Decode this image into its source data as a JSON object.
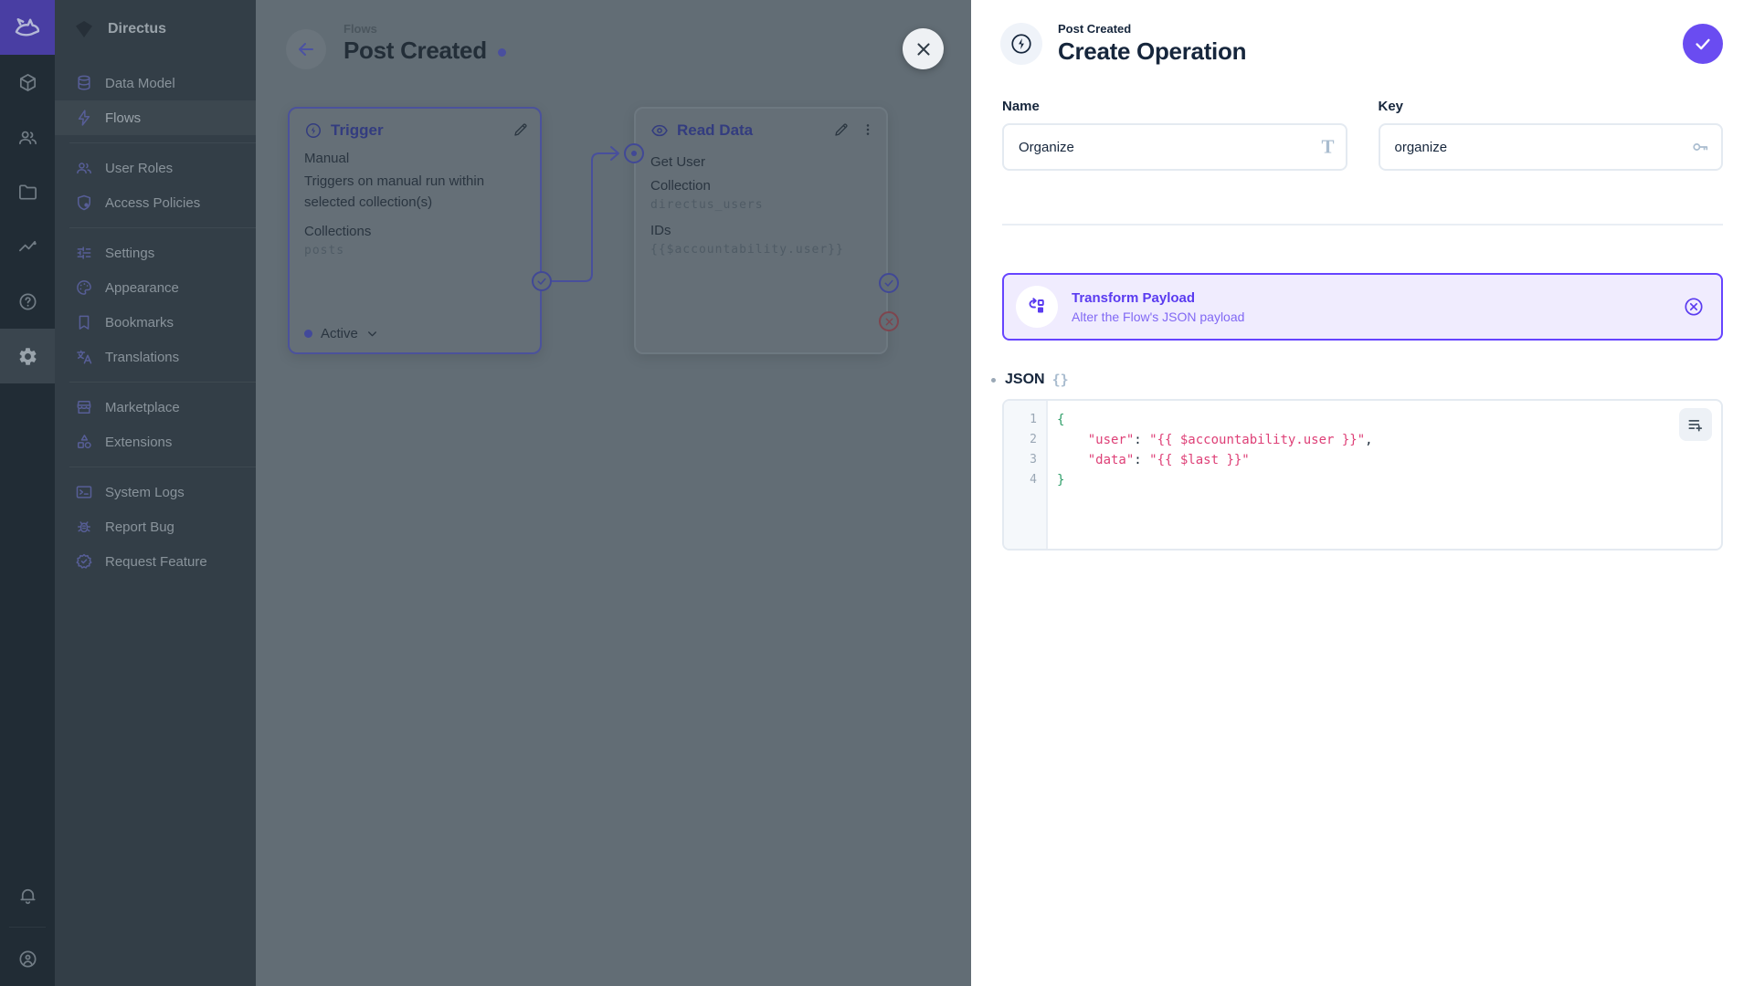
{
  "colors": {
    "brand_accent": "#6644ff",
    "save_button": "#6a4cf1",
    "card_border": "#6644ff",
    "code_bracket_green": "#2f9e69",
    "code_string_rose": "#de4077"
  },
  "module_bar": {
    "modules": [
      "content",
      "users",
      "files",
      "insights",
      "help",
      "settings"
    ],
    "active_module": "settings",
    "bottom": [
      "notifications",
      "avatar"
    ]
  },
  "sidebar": {
    "project_name": "Directus",
    "groups": [
      {
        "items": [
          {
            "label": "Data Model"
          },
          {
            "label": "Flows",
            "active": true
          }
        ]
      },
      {
        "items": [
          {
            "label": "User Roles"
          },
          {
            "label": "Access Policies"
          }
        ]
      },
      {
        "items": [
          {
            "label": "Settings"
          },
          {
            "label": "Appearance"
          },
          {
            "label": "Bookmarks"
          },
          {
            "label": "Translations"
          }
        ]
      },
      {
        "items": [
          {
            "label": "Marketplace"
          },
          {
            "label": "Extensions"
          }
        ]
      },
      {
        "items": [
          {
            "label": "System Logs"
          },
          {
            "label": "Report Bug"
          },
          {
            "label": "Request Feature"
          }
        ]
      }
    ]
  },
  "canvas": {
    "breadcrumb": "Flows",
    "title": "Post Created",
    "trigger": {
      "header": "Trigger",
      "type": "Manual",
      "description": "Triggers on manual run within selected collection(s)",
      "collections_label": "Collections",
      "collections_value": "posts",
      "status": "Active"
    },
    "read_data": {
      "header": "Read Data",
      "name": "Get User",
      "collection_label": "Collection",
      "collection_value": "directus_users",
      "ids_label": "IDs",
      "ids_value": "{{$accountability.user}}"
    }
  },
  "drawer": {
    "subtitle": "Post Created",
    "title": "Create Operation",
    "name_field": {
      "label": "Name",
      "value": "Organize",
      "icon_glyph": "T"
    },
    "key_field": {
      "label": "Key",
      "value": "organize"
    },
    "card": {
      "title": "Transform Payload",
      "subtitle": "Alter the Flow's JSON payload"
    },
    "json_section": {
      "label": "JSON",
      "icon_glyph": "{}"
    },
    "editor": {
      "lines": [
        {
          "num": "1",
          "tokens": [
            {
              "text": "{",
              "type": "bracket"
            }
          ]
        },
        {
          "num": "2",
          "tokens": [
            {
              "text": "    ",
              "type": "plain"
            },
            {
              "text": "\"user\"",
              "type": "string"
            },
            {
              "text": ": ",
              "type": "plain"
            },
            {
              "text": "\"{{ $accountability.user }}\"",
              "type": "string"
            },
            {
              "text": ",",
              "type": "plain"
            }
          ]
        },
        {
          "num": "3",
          "tokens": [
            {
              "text": "    ",
              "type": "plain"
            },
            {
              "text": "\"data\"",
              "type": "string"
            },
            {
              "text": ": ",
              "type": "plain"
            },
            {
              "text": "\"{{ $last }}\"",
              "type": "string"
            }
          ]
        },
        {
          "num": "4",
          "tokens": [
            {
              "text": "}",
              "type": "bracket"
            }
          ]
        }
      ]
    }
  }
}
